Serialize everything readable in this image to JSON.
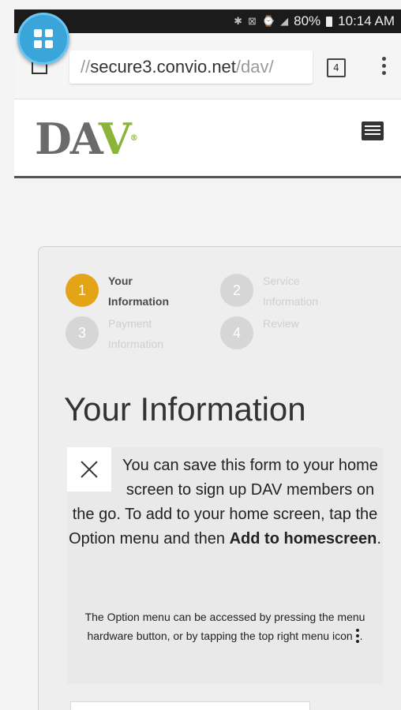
{
  "status_bar": {
    "battery": "80%",
    "time": "10:14 AM"
  },
  "launcher": {
    "icon": "grid-icon",
    "color": "#39a5d8"
  },
  "browser": {
    "url_prefix": "//",
    "url_host": "secure3.convio.net",
    "url_path": "/dav/",
    "tab_count": "4"
  },
  "site": {
    "logo": "DAV",
    "brand_gray": "#6a6a6a",
    "brand_green": "#8ab43a"
  },
  "stepper": {
    "active_color": "#e3a418",
    "steps": [
      {
        "number": "1",
        "line1": "Your",
        "line2": "Information"
      },
      {
        "number": "2",
        "line1": "Service",
        "line2": "Information"
      },
      {
        "number": "3",
        "line1": "Payment",
        "line2": "Information"
      },
      {
        "number": "4",
        "line1": "Review",
        "line2": ""
      }
    ]
  },
  "form": {
    "section_title": "Your Information"
  },
  "popup": {
    "message_before": "You can save this form to your home screen to sign up DAV members on the go. To add to your home screen, tap the Option menu and then ",
    "message_bold": "Add to homescreen",
    "message_after": ".",
    "note": "The Option menu can be accessed by pressing the menu hardware button, or by tapping the top right menu icon",
    "note_end": "."
  }
}
